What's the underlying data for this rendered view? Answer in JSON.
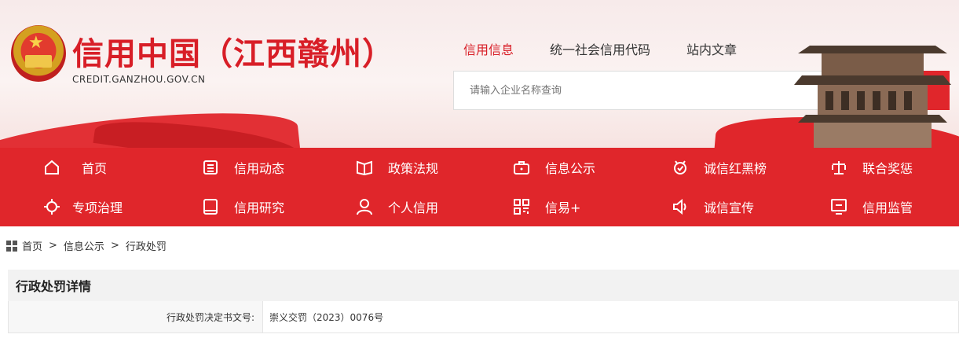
{
  "site": {
    "title": "信用中国（江西赣州）",
    "url": "CREDIT.GANZHOU.GOV.CN"
  },
  "search": {
    "tabs": [
      {
        "label": "信用信息",
        "active": true
      },
      {
        "label": "统一社会信用代码",
        "active": false
      },
      {
        "label": "站内文章",
        "active": false
      }
    ],
    "placeholder": "请输入企业名称查询"
  },
  "nav": {
    "row1": [
      {
        "label": "首页",
        "icon": "home-icon"
      },
      {
        "label": "信用动态",
        "icon": "list-icon"
      },
      {
        "label": "政策法规",
        "icon": "book-icon"
      },
      {
        "label": "信息公示",
        "icon": "briefcase-icon"
      },
      {
        "label": "诚信红黑榜",
        "icon": "badge-icon"
      },
      {
        "label": "联合奖惩",
        "icon": "scale-icon"
      }
    ],
    "row2": [
      {
        "label": "专项治理",
        "icon": "target-icon"
      },
      {
        "label": "信用研究",
        "icon": "notebook-icon"
      },
      {
        "label": "个人信用",
        "icon": "user-icon"
      },
      {
        "label": "信易+",
        "icon": "grid-icon"
      },
      {
        "label": "诚信宣传",
        "icon": "speaker-icon"
      },
      {
        "label": "信用监管",
        "icon": "monitor-icon"
      }
    ]
  },
  "breadcrumb": {
    "items": [
      "首页",
      "信息公示",
      "行政处罚"
    ],
    "separator": ">"
  },
  "detail": {
    "title": "行政处罚详情",
    "rows": [
      {
        "label": "行政处罚决定书文号:",
        "value": "崇义交罚（2023）0076号"
      }
    ]
  },
  "colors": {
    "brand_red": "#e0262b",
    "title_red": "#d81e27"
  }
}
